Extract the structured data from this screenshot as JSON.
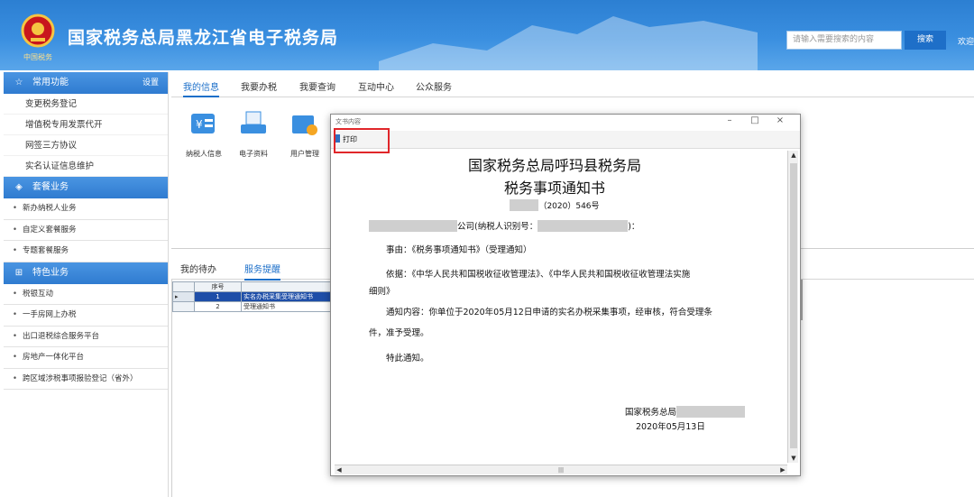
{
  "header": {
    "title": "国家税务总局黑龙江省电子税务局",
    "brand_sub": "中国税务",
    "search_placeholder": "请输入需要搜索的内容",
    "search_button": "搜索",
    "welcome": "欢迎"
  },
  "sidebar": {
    "common": {
      "title": "常用功能",
      "settings": "设置",
      "items": [
        "变更税务登记",
        "增值税专用发票代开",
        "网签三方协议",
        "实名认证信息维护"
      ]
    },
    "package": {
      "title": "套餐业务",
      "items": [
        "新办纳税人业务",
        "自定义套餐服务",
        "专题套餐服务"
      ]
    },
    "special": {
      "title": "特色业务",
      "items": [
        "税银互动",
        "一手房网上办税",
        "出口退税综合服务平台",
        "房地产一体化平台",
        "跨区域涉税事项报验登记（省外）"
      ]
    }
  },
  "tabs": [
    "我的信息",
    "我要办税",
    "我要查询",
    "互动中心",
    "公众服务"
  ],
  "apps": [
    {
      "label": "纳税人信息",
      "icon": "taxpayer-info-icon"
    },
    {
      "label": "电子资料",
      "icon": "electronic-docs-icon"
    },
    {
      "label": "用户管理",
      "icon": "user-management-icon"
    }
  ],
  "lower_tabs": [
    "我的待办",
    "服务提醒"
  ],
  "grid": {
    "header": "序号",
    "rows": [
      {
        "num": "1",
        "title": "实名办税采集受理通知书"
      },
      {
        "num": "2",
        "title": "受理通知书"
      }
    ]
  },
  "dialog": {
    "title": "文书内容",
    "print": "打印",
    "doc": {
      "title1": "国家税务总局呼玛县税务局",
      "title2": "税务事项通知书",
      "number": "（2020）546号",
      "addressee_mid": "公司(纳税人识别号：",
      "addressee_end": ")：",
      "subject": "事由：《税务事项通知书》（受理通知）",
      "basis_1": "依据：《中华人民共和国税收征收管理法》、《中华人民共和国税收征收管理法实施",
      "basis_2": "细则》",
      "content_1": "通知内容：你单位于2020年05月12日申请的实名办税采集事项，经审核，符合受理条",
      "content_2": "件，准予受理。",
      "closing": "特此通知。",
      "signature": "国家税务总局",
      "date": "2020年05月13日"
    }
  },
  "colors": {
    "accent": "#1c6fc9",
    "header": "#3a8fe0",
    "highlight": "#e0262a"
  }
}
